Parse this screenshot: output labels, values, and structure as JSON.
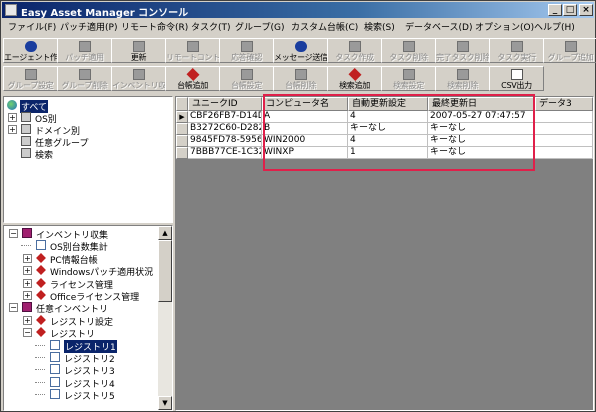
{
  "window": {
    "title": "Easy Asset Manager コンソール",
    "controls": [
      "_",
      "□",
      "×"
    ]
  },
  "menu": [
    "ファイル(F)",
    "パッチ適用(P)",
    "リモート命令(R)",
    "タスク(T)",
    "グループ(G)",
    "カスタム台帳(C)",
    "検索(S)",
    "データベース(D)",
    "オプション(O)",
    "ヘルプ(H)"
  ],
  "toolbar1": [
    {
      "label": "エージェント作成",
      "icon": "info-icon",
      "enabled": true
    },
    {
      "label": "パッチ適用",
      "icon": "patch-icon",
      "enabled": false
    },
    {
      "label": "更新",
      "icon": "refresh-icon",
      "enabled": true
    },
    {
      "label": "リモートコントロール",
      "icon": "remote-control-icon",
      "enabled": false
    },
    {
      "label": "応答確認",
      "icon": "response-check-icon",
      "enabled": false
    },
    {
      "label": "メッセージ送信",
      "icon": "message-send-icon",
      "enabled": true
    },
    {
      "label": "タスク作成",
      "icon": "task-create-icon",
      "enabled": false
    },
    {
      "label": "タスク削除",
      "icon": "task-delete-icon",
      "enabled": false
    },
    {
      "label": "完了タスク削除",
      "icon": "completed-task-delete-icon",
      "enabled": false
    },
    {
      "label": "タスク実行",
      "icon": "task-run-icon",
      "enabled": false
    },
    {
      "label": "グループ追加",
      "icon": "group-add-icon",
      "enabled": false
    }
  ],
  "toolbar2": [
    {
      "label": "グループ設定",
      "icon": "group-settings-icon",
      "enabled": false
    },
    {
      "label": "グループ削除",
      "icon": "group-delete-icon",
      "enabled": false
    },
    {
      "label": "インベントリ収集",
      "icon": "inventory-collect-icon",
      "enabled": false
    },
    {
      "label": "台帳追加",
      "icon": "ledger-add-icon",
      "enabled": true
    },
    {
      "label": "台帳設定",
      "icon": "ledger-settings-icon",
      "enabled": false
    },
    {
      "label": "台帳削除",
      "icon": "ledger-delete-icon",
      "enabled": false
    },
    {
      "label": "検索追加",
      "icon": "search-add-icon",
      "enabled": true
    },
    {
      "label": "検索設定",
      "icon": "search-settings-icon",
      "enabled": false
    },
    {
      "label": "検索削除",
      "icon": "search-delete-icon",
      "enabled": false
    },
    {
      "label": "CSV出力",
      "icon": "csv-export-icon",
      "enabled": true
    }
  ],
  "tree_top": [
    {
      "label": "すべて",
      "icon": "globe-icon",
      "selected": true,
      "expander": ""
    },
    {
      "label": "OS別",
      "icon": "computer-icon",
      "selected": false,
      "expander": "+"
    },
    {
      "label": "ドメイン別",
      "icon": "computer-icon",
      "selected": false,
      "expander": "+"
    },
    {
      "label": "任意グループ",
      "icon": "computer-icon",
      "selected": false,
      "expander": ""
    },
    {
      "label": "検索",
      "icon": "computer-icon",
      "selected": false,
      "expander": ""
    }
  ],
  "tree_bottom": [
    {
      "label": "インベントリ収集",
      "icon": "book-icon",
      "level": 0,
      "expander": "−",
      "selected": false
    },
    {
      "label": "OS別台数集計",
      "icon": "sheet-icon",
      "level": 1,
      "expander": "",
      "selected": false
    },
    {
      "label": "PC情報台帳",
      "icon": "diamond-icon",
      "level": 1,
      "expander": "+",
      "selected": false
    },
    {
      "label": "Windowsパッチ適用状況",
      "icon": "diamond-icon",
      "level": 1,
      "expander": "+",
      "selected": false
    },
    {
      "label": "ライセンス管理",
      "icon": "diamond-icon",
      "level": 1,
      "expander": "+",
      "selected": false
    },
    {
      "label": "Officeライセンス管理",
      "icon": "diamond-icon",
      "level": 1,
      "expander": "+",
      "selected": false
    },
    {
      "label": "任意インベントリ",
      "icon": "book-icon",
      "level": 0,
      "expander": "−",
      "selected": false
    },
    {
      "label": "レジストリ設定",
      "icon": "diamond-icon",
      "level": 1,
      "expander": "+",
      "selected": false
    },
    {
      "label": "レジストリ",
      "icon": "diamond-icon",
      "level": 1,
      "expander": "−",
      "selected": false
    },
    {
      "label": "レジストリ1",
      "icon": "sheet-icon",
      "level": 2,
      "expander": "",
      "selected": true
    },
    {
      "label": "レジストリ2",
      "icon": "sheet-icon",
      "level": 2,
      "expander": "",
      "selected": false
    },
    {
      "label": "レジストリ3",
      "icon": "sheet-icon",
      "level": 2,
      "expander": "",
      "selected": false
    },
    {
      "label": "レジストリ4",
      "icon": "sheet-icon",
      "level": 2,
      "expander": "",
      "selected": false
    },
    {
      "label": "レジストリ5",
      "icon": "sheet-icon",
      "level": 2,
      "expander": "",
      "selected": false
    }
  ],
  "grid": {
    "columns": [
      "ユニークID",
      "コンピュータ名",
      "自動更新設定",
      "最終更新日",
      "データ3"
    ],
    "rows": [
      {
        "current": true,
        "cells": [
          "CBF26FB7-D14D",
          "A",
          "4",
          "2007-05-27 07:47:57",
          ""
        ]
      },
      {
        "current": false,
        "cells": [
          "B3272C60-D282-",
          "B",
          "キーなし",
          "キーなし",
          ""
        ]
      },
      {
        "current": false,
        "cells": [
          "9845FD78-5956-",
          "WIN2000",
          "4",
          "キーなし",
          ""
        ]
      },
      {
        "current": false,
        "cells": [
          "7BBB77CE-1C32",
          "WINXP",
          "1",
          "キーなし",
          ""
        ]
      }
    ],
    "current_row_marker": "▶"
  },
  "colors": {
    "title_bar": "#0a246a",
    "highlight_box": "#e0204a",
    "selection": "#0a246a",
    "face": "#d4d0c8"
  }
}
